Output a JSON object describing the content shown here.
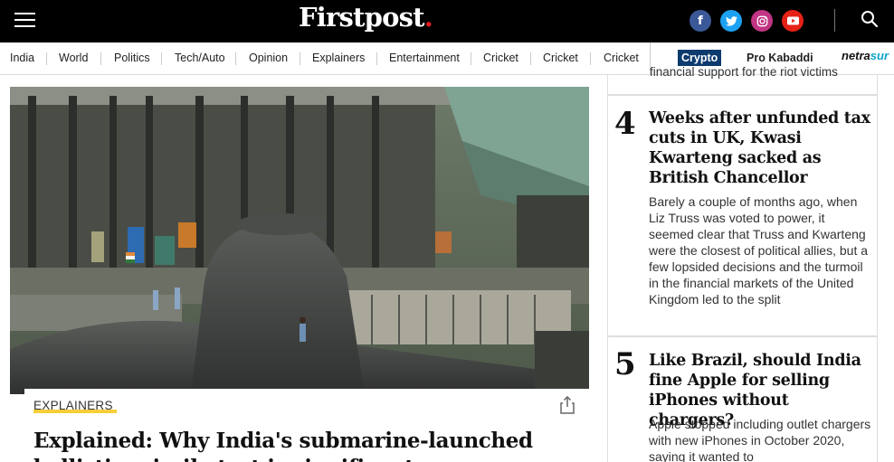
{
  "header": {
    "logo_text": "Firstpost",
    "logo_dot": ".",
    "social": [
      {
        "name": "facebook",
        "glyph": "f",
        "color": "#3b5998"
      },
      {
        "name": "twitter",
        "glyph": "t",
        "color": "#1da1f2"
      },
      {
        "name": "instagram",
        "glyph": "◎",
        "color": "#c13584"
      },
      {
        "name": "youtube",
        "glyph": "▶",
        "color": "#e62117"
      }
    ]
  },
  "nav": {
    "items": [
      "India",
      "World",
      "Politics",
      "Tech/Auto",
      "Opinion",
      "Explainers",
      "Entertainment",
      "Cricket",
      "Cricket",
      "Cricket"
    ],
    "crypto": "Crypto",
    "kabaddi": "Pro Kabaddi",
    "netra_main": "netra",
    "netra_sub": "sur"
  },
  "main": {
    "tag": "EXPLAINERS",
    "headline": "Explained: Why India's submarine-launched ballistic missile test is significant"
  },
  "sidebar": {
    "partial_line": "financial support for the riot victims",
    "stories": [
      {
        "number": "4",
        "title": "Weeks after unfunded tax cuts in UK, Kwasi Kwarteng sacked as British Chancellor",
        "summary": "Barely a couple of months ago, when Liz Truss was voted to power, it seemed clear that Truss and Kwarteng were the closest of political allies, but a few lopsided decisions and the turmoil in the financial markets of the United Kingdom led to the split"
      },
      {
        "number": "5",
        "title": "Like Brazil, should India fine Apple for selling iPhones without chargers?",
        "summary": "Apple stopped including outlet chargers with new iPhones in October 2020, saying it wanted to"
      }
    ]
  },
  "colors": {
    "topbar": "#000000",
    "logo_dot": "#e41b23",
    "crypto_bg": "#0d3b6e",
    "tag_underline": "#f5c518"
  }
}
